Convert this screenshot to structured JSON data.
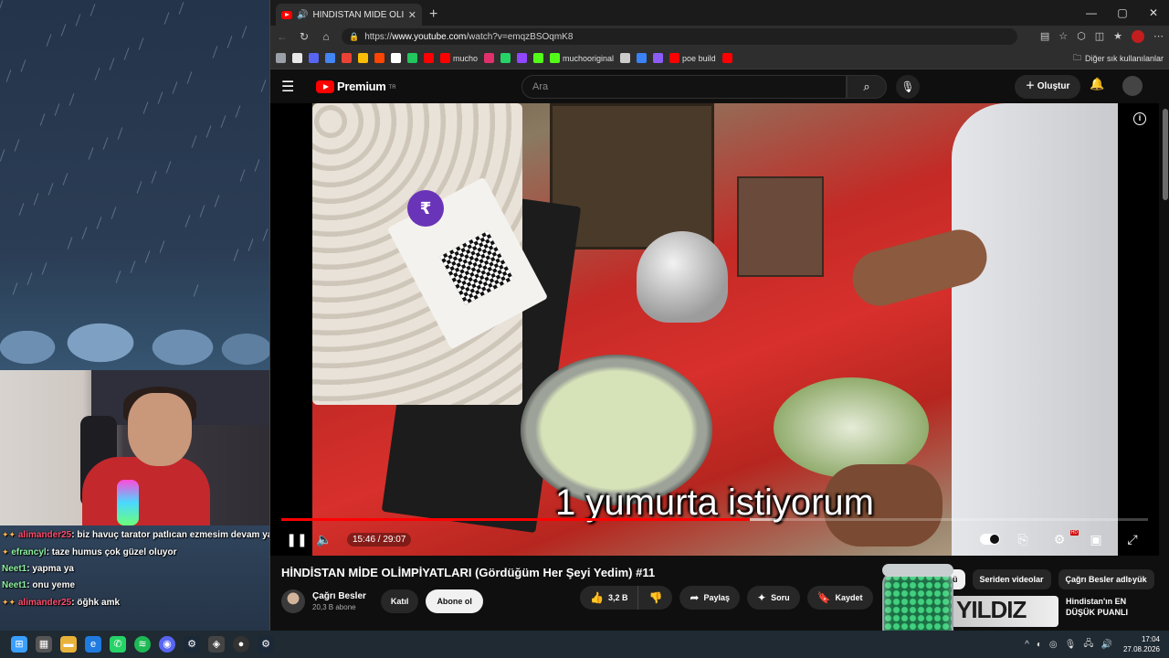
{
  "tab": {
    "title": "HİNDİSTAN MİDE OLİMPİYATI",
    "close": "✕",
    "new_tab": "+"
  },
  "window_controls": {
    "minimize": "—",
    "maximize": "▢",
    "close": "✕"
  },
  "address_bar": {
    "url_prefix": "https://",
    "url_host": "www.youtube.com",
    "url_path": "/watch?v=emqzBSOqmK8"
  },
  "bookmarks": {
    "items": [
      {
        "label": "",
        "color": "#9aa0a6"
      },
      {
        "label": "",
        "color": "#e8e8e8"
      },
      {
        "label": "",
        "color": "#5865f2"
      },
      {
        "label": "",
        "color": "#4285f4"
      },
      {
        "label": "",
        "color": "#ea4335"
      },
      {
        "label": "",
        "color": "#fbbc05"
      },
      {
        "label": "",
        "color": "#ff4500"
      },
      {
        "label": "",
        "color": "#ffffff"
      },
      {
        "label": "",
        "color": "#22c55e"
      },
      {
        "label": "",
        "color": "#ff0000"
      },
      {
        "label": "mucho",
        "color": "#ff0000"
      },
      {
        "label": "",
        "color": "#e1306c"
      },
      {
        "label": "",
        "color": "#25d366"
      },
      {
        "label": "",
        "color": "#9146ff"
      },
      {
        "label": "",
        "color": "#53fc18"
      },
      {
        "label": "muchooriginal",
        "color": "#53fc18"
      },
      {
        "label": "",
        "color": "#cccccc"
      },
      {
        "label": "",
        "color": "#3b82f6"
      },
      {
        "label": "",
        "color": "#8b5cf6"
      },
      {
        "label": "poe build",
        "color": "#ff0000"
      },
      {
        "label": "",
        "color": "#ff0000"
      }
    ],
    "other": "Diğer sık kullanılanlar"
  },
  "youtube": {
    "brand": "Premium",
    "region": "TR",
    "search_placeholder": "Ara",
    "create_label": "Oluştur",
    "video": {
      "subtitle": "1 yumurta istiyorum",
      "time_current": "15:46",
      "time_total": "29:07",
      "time_display": "15:46 / 29:07",
      "progress_fraction": 0.541,
      "loaded_fraction": 0.57
    },
    "title": "HİNDİSTAN MİDE OLİMPİYATLARI (Gördüğüm Her Şeyi Yedim) #11",
    "channel": {
      "name": "Çağrı Besler",
      "subscribers": "20,3 B abone"
    },
    "join_label": "Katıl",
    "subscribe_label": "Abone ol",
    "likes": "3,2 B",
    "share_label": "Paylaş",
    "ask_label": "Soru",
    "save_label": "Kaydet",
    "chips": [
      "Tümü",
      "Seriden videolar",
      "Çağrı Besler adlı yük"
    ],
    "recommended": {
      "thumb_text": "YILDIZ",
      "title": "Hindistan'ın EN DÜŞÜK PUANLI"
    }
  },
  "chat": [
    {
      "user": "alimander25",
      "user_color": "#ff4d6d",
      "message": "biz havuç tarator patlıcan ezmesim devam ya"
    },
    {
      "user": "efrancyl",
      "user_color": "#8ef0a0",
      "message": "taze humus çok güzel oluyor"
    },
    {
      "user": "Neet1",
      "user_color": "#8ef0a0",
      "message": "yapma ya"
    },
    {
      "user": "Neet1",
      "user_color": "#8ef0a0",
      "message": "onu yeme"
    },
    {
      "user": "alimander25",
      "user_color": "#ff4d6d",
      "message": "öğhk amk"
    }
  ],
  "taskbar": {
    "time": "17:04",
    "date": "27.08.2026"
  }
}
